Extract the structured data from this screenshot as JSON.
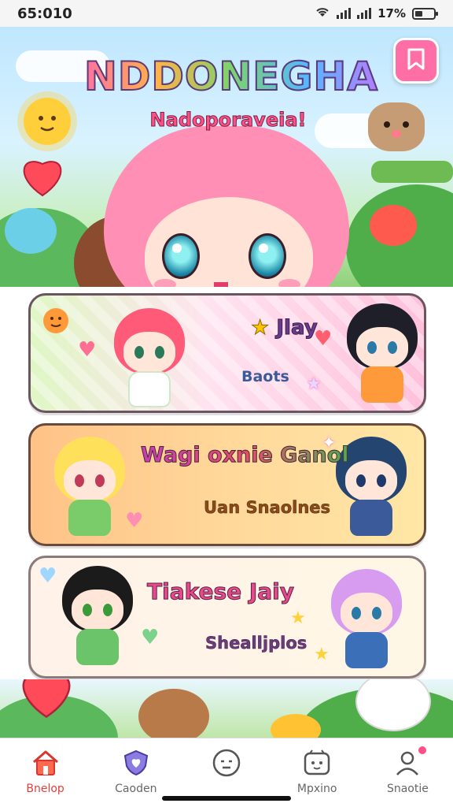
{
  "status_bar": {
    "time": "65:010",
    "battery": "17%"
  },
  "header": {
    "title": "NDDONEGHA",
    "subtitle": "Nadoporaveia!",
    "menu_icon": "bookmark-icon"
  },
  "cards": [
    {
      "title": "Jlay",
      "subtitle": "Baots",
      "title_icon": "star-icon"
    },
    {
      "title": "Wagi oxnie Ganol",
      "subtitle": "Uan Snaolnes"
    },
    {
      "title": "Tiakese Jaiy",
      "subtitle": "Shealljplos"
    }
  ],
  "tabbar": {
    "items": [
      {
        "label": "Bnelop",
        "icon": "home-icon",
        "active": true
      },
      {
        "label": "Caoden",
        "icon": "shield-heart-icon",
        "active": false
      },
      {
        "label": "",
        "icon": "face-icon",
        "active": false
      },
      {
        "label": "Mpxino",
        "icon": "game-icon",
        "active": false
      },
      {
        "label": "Snaotie",
        "icon": "profile-icon",
        "active": false
      }
    ]
  },
  "colors": {
    "accent_pink": "#ff6fa5",
    "tab_active": "#e23d3d"
  }
}
